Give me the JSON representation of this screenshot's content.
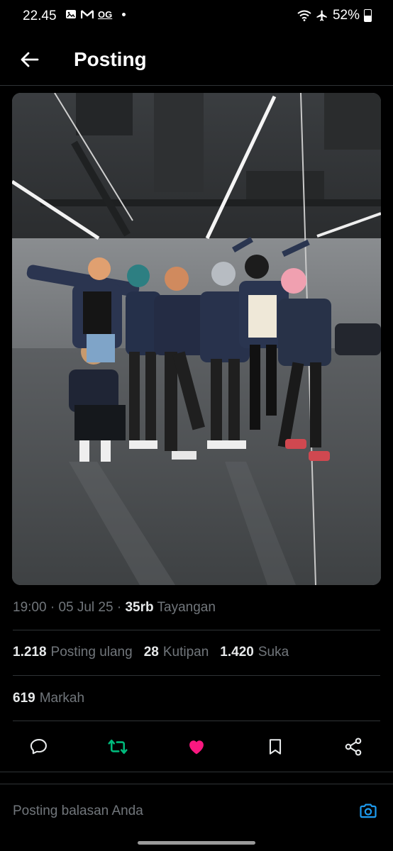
{
  "status_bar": {
    "time": "22.45",
    "carrier_badge": "OG",
    "battery": "52%"
  },
  "header": {
    "title": "Posting"
  },
  "post": {
    "time": "19:00",
    "date": "05 Jul 25",
    "views_count": "35rb",
    "views_label": "Tayangan",
    "reposts_count": "1.218",
    "reposts_label": "Posting ulang",
    "quotes_count": "28",
    "quotes_label": "Kutipan",
    "likes_count": "1.420",
    "likes_label": "Suka",
    "bookmarks_count": "619",
    "bookmarks_label": "Markah"
  },
  "actions": {
    "reply_icon": "reply-icon",
    "repost_icon": "repost-icon",
    "like_icon": "heart-icon",
    "bookmark_icon": "bookmark-icon",
    "share_icon": "share-icon",
    "repost_color": "#00ba7c",
    "like_color": "#f91880"
  },
  "reply_bar": {
    "placeholder": "Posting balasan Anda"
  },
  "colors": {
    "background": "#000000",
    "text_primary": "#e7e9ea",
    "text_secondary": "#71767b",
    "divider": "#2f3336",
    "accent": "#1d9bf0"
  }
}
